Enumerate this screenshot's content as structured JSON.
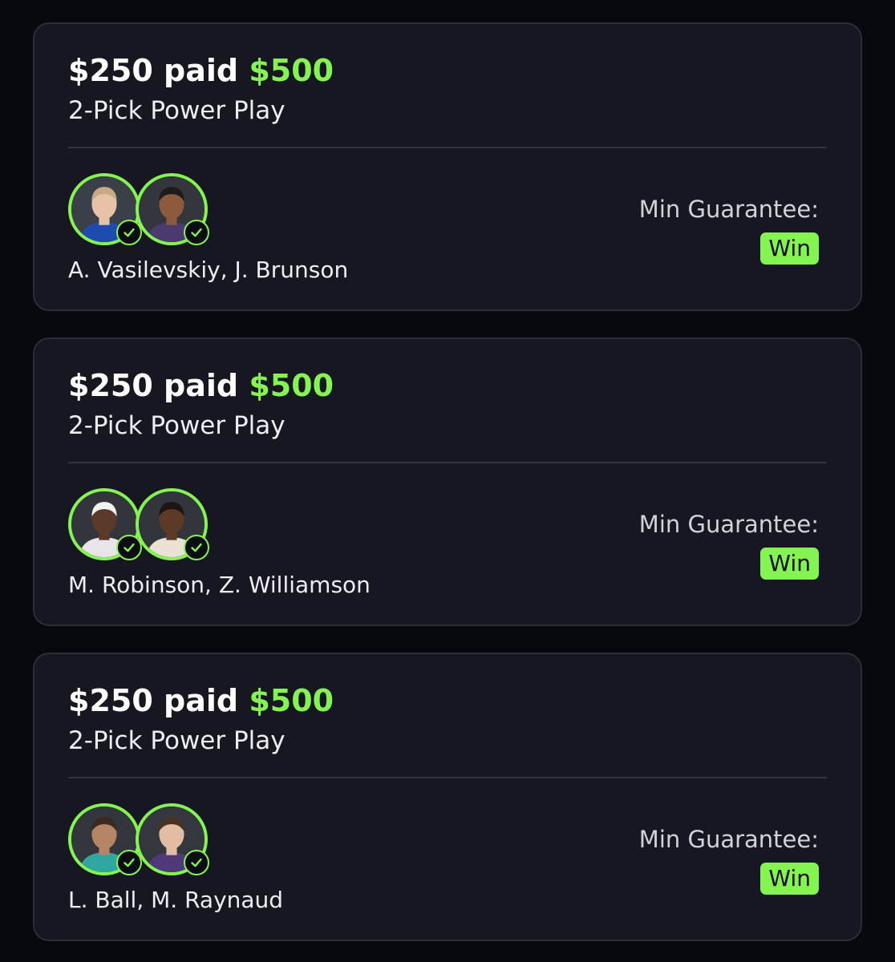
{
  "entries": [
    {
      "paid_amount": "$250",
      "paid_word": "paid",
      "payout_amount": "$500",
      "play_type": "2-Pick Power Play",
      "players": "A. Vasilevskiy, J. Brunson",
      "min_guarantee_label": "Min Guarantee:",
      "result": "Win",
      "avatar_colors": [
        {
          "bg": "#3a3f48",
          "skin": "#e7c2a8",
          "hair": "#c7a985",
          "shirt": "#1d4bb0"
        },
        {
          "bg": "#34363d",
          "skin": "#8c5a3c",
          "hair": "#1f1a18",
          "shirt": "#4a3a70"
        }
      ]
    },
    {
      "paid_amount": "$250",
      "paid_word": "paid",
      "payout_amount": "$500",
      "play_type": "2-Pick Power Play",
      "players": "M. Robinson, Z. Williamson",
      "min_guarantee_label": "Min Guarantee:",
      "result": "Win",
      "avatar_colors": [
        {
          "bg": "#33353c",
          "skin": "#5a3a29",
          "hair": "#f2f2f2",
          "shirt": "#e8e4ea"
        },
        {
          "bg": "#33353c",
          "skin": "#5d3a26",
          "hair": "#1c1513",
          "shirt": "#e8e1d4"
        }
      ]
    },
    {
      "paid_amount": "$250",
      "paid_word": "paid",
      "payout_amount": "$500",
      "play_type": "2-Pick Power Play",
      "players": "L. Ball, M. Raynaud",
      "min_guarantee_label": "Min Guarantee:",
      "result": "Win",
      "avatar_colors": [
        {
          "bg": "#33363d",
          "skin": "#b58565",
          "hair": "#3b2a1e",
          "shirt": "#2fa7a0"
        },
        {
          "bg": "#35373e",
          "skin": "#e3bda3",
          "hair": "#4a3223",
          "shirt": "#4e3a78"
        }
      ]
    }
  ],
  "colors": {
    "background": "#08090f",
    "card": "#161720",
    "accent_green": "#84f550"
  },
  "icons": [
    "player-avatar",
    "checkmark-icon"
  ]
}
